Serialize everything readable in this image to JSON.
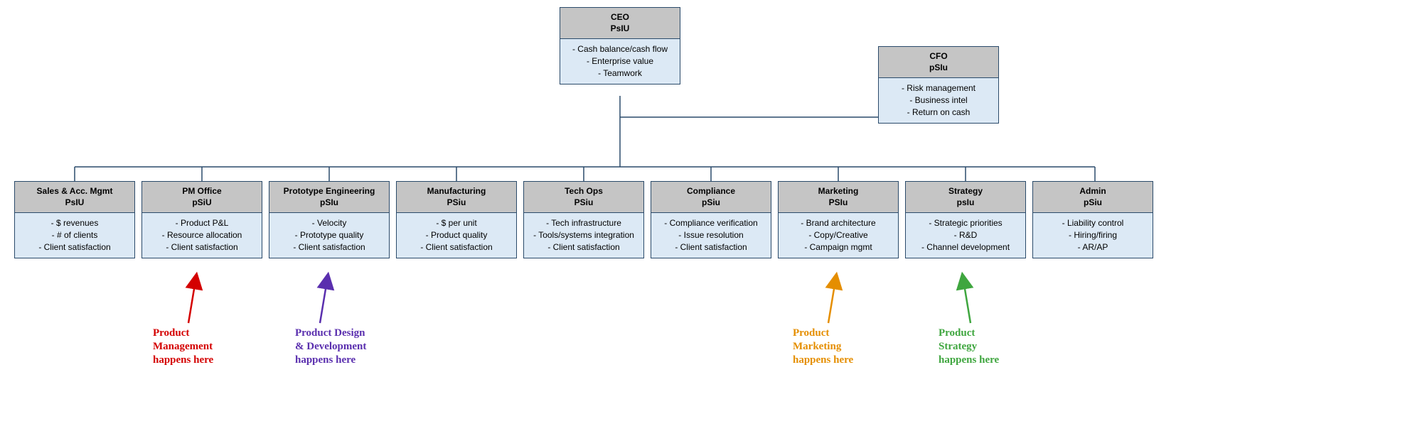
{
  "ceo": {
    "title": "CEO",
    "code": "PsIU",
    "items": [
      "- Cash balance/cash flow",
      "- Enterprise value",
      "- Teamwork"
    ]
  },
  "cfo": {
    "title": "CFO",
    "code": "pSIu",
    "items": [
      "- Risk management",
      "- Business intel",
      "- Return on cash"
    ]
  },
  "row": [
    {
      "title": "Sales & Acc. Mgmt",
      "code": "PsIU",
      "items": [
        "- $ revenues",
        "- # of clients",
        "- Client satisfaction"
      ]
    },
    {
      "title": "PM Office",
      "code": "pSiU",
      "items": [
        "- Product P&L",
        "- Resource allocation",
        "- Client satisfaction"
      ]
    },
    {
      "title": "Prototype Engineering",
      "code": "pSIu",
      "items": [
        "- Velocity",
        "- Prototype quality",
        "- Client satisfaction"
      ]
    },
    {
      "title": "Manufacturing",
      "code": "PSiu",
      "items": [
        "- $ per unit",
        "- Product  quality",
        "- Client satisfaction"
      ]
    },
    {
      "title": "Tech Ops",
      "code": "PSiu",
      "items": [
        "- Tech infrastructure",
        "- Tools/systems integration",
        "- Client satisfaction"
      ]
    },
    {
      "title": "Compliance",
      "code": "pSiu",
      "items": [
        "- Compliance verification",
        "- Issue resolution",
        "- Client satisfaction"
      ]
    },
    {
      "title": "Marketing",
      "code": "PSIu",
      "items": [
        "- Brand architecture",
        "- Copy/Creative",
        "- Campaign mgmt"
      ]
    },
    {
      "title": "Strategy",
      "code": "psIu",
      "items": [
        "- Strategic priorities",
        "- R&D",
        "- Channel development"
      ]
    },
    {
      "title": "Admin",
      "code": "pSiu",
      "items": [
        "- Liability control",
        "- Hiring/firing",
        "- AR/AP"
      ]
    }
  ],
  "annotations": {
    "pm": {
      "text": "Product\nManagement\nhappens here",
      "color": "#d40000"
    },
    "proto": {
      "text": "Product Design\n& Development\nhappens here",
      "color": "#5a2fae"
    },
    "marketing": {
      "text": "Product\nMarketing\nhappens here",
      "color": "#e58e00"
    },
    "strategy": {
      "text": "Product\nStrategy\nhappens here",
      "color": "#3fa63f"
    }
  }
}
